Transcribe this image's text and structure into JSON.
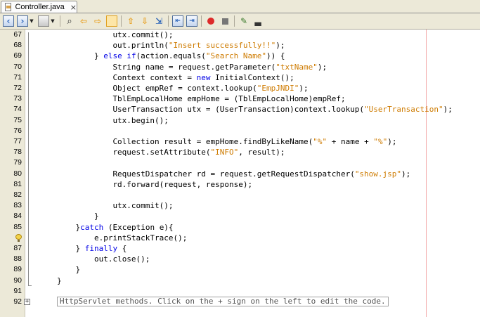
{
  "tab": {
    "label": "Controller.java",
    "close": "×"
  },
  "toolbar": {
    "buttons": [
      "back-icon",
      "forward-icon",
      "history-icon",
      "find-icon",
      "find-previous-icon",
      "find-next-icon",
      "toggle-highlight-icon",
      "previous-bookmark-icon",
      "next-bookmark-icon",
      "toggle-bookmark-icon",
      "shift-left-icon",
      "shift-right-icon",
      "start-macro-icon",
      "stop-macro-icon",
      "comment-icon",
      "uncomment-icon"
    ]
  },
  "lines": [
    {
      "n": "67",
      "indent": 12,
      "parts": [
        [
          "utx.commit();",
          ""
        ]
      ]
    },
    {
      "n": "68",
      "indent": 12,
      "parts": [
        [
          "out.println(",
          ""
        ],
        [
          "\"Insert successfully!!\"",
          "str"
        ],
        [
          ");",
          ""
        ]
      ]
    },
    {
      "n": "69",
      "indent": 8,
      "parts": [
        [
          "} ",
          ""
        ],
        [
          "else if",
          "kw"
        ],
        [
          "(action.equals(",
          ""
        ],
        [
          "\"Search Name\"",
          "str"
        ],
        [
          ")) {",
          ""
        ]
      ]
    },
    {
      "n": "70",
      "indent": 12,
      "parts": [
        [
          "String name = request.getParameter(",
          ""
        ],
        [
          "\"txtName\"",
          "str"
        ],
        [
          ");",
          ""
        ]
      ]
    },
    {
      "n": "71",
      "indent": 12,
      "parts": [
        [
          "Context context = ",
          ""
        ],
        [
          "new",
          "kw"
        ],
        [
          " InitialContext();",
          ""
        ]
      ]
    },
    {
      "n": "72",
      "indent": 12,
      "parts": [
        [
          "Object empRef = context.lookup(",
          ""
        ],
        [
          "\"EmpJNDI\"",
          "str"
        ],
        [
          ");",
          ""
        ]
      ]
    },
    {
      "n": "73",
      "indent": 12,
      "parts": [
        [
          "TblEmpLocalHome empHome = (TblEmpLocalHome)empRef;",
          ""
        ]
      ]
    },
    {
      "n": "74",
      "indent": 12,
      "parts": [
        [
          "UserTransaction utx = (UserTransaction)context.lookup(",
          ""
        ],
        [
          "\"UserTransaction\"",
          "str"
        ],
        [
          ");",
          ""
        ]
      ]
    },
    {
      "n": "75",
      "indent": 12,
      "parts": [
        [
          "utx.begin();",
          ""
        ]
      ]
    },
    {
      "n": "76",
      "indent": 0,
      "parts": []
    },
    {
      "n": "77",
      "indent": 12,
      "parts": [
        [
          "Collection result = empHome.findByLikeName(",
          ""
        ],
        [
          "\"%\"",
          "str"
        ],
        [
          " + name + ",
          ""
        ],
        [
          "\"%\"",
          "str"
        ],
        [
          ");",
          ""
        ]
      ]
    },
    {
      "n": "78",
      "indent": 12,
      "parts": [
        [
          "request.setAttribute(",
          ""
        ],
        [
          "\"INFO\"",
          "str"
        ],
        [
          ", result);",
          ""
        ]
      ]
    },
    {
      "n": "79",
      "indent": 0,
      "parts": []
    },
    {
      "n": "80",
      "indent": 12,
      "parts": [
        [
          "RequestDispatcher rd = request.getRequestDispatcher(",
          ""
        ],
        [
          "\"show.jsp\"",
          "str"
        ],
        [
          ");",
          ""
        ]
      ]
    },
    {
      "n": "81",
      "indent": 12,
      "parts": [
        [
          "rd.forward(request, response);",
          ""
        ]
      ]
    },
    {
      "n": "82",
      "indent": 0,
      "parts": []
    },
    {
      "n": "83",
      "indent": 12,
      "parts": [
        [
          "utx.commit();",
          ""
        ]
      ]
    },
    {
      "n": "84",
      "indent": 8,
      "parts": [
        [
          "}",
          ""
        ]
      ]
    },
    {
      "n": "85",
      "indent": 4,
      "parts": [
        [
          "}",
          ""
        ],
        [
          "catch",
          "kw"
        ],
        [
          " (Exception e){",
          ""
        ]
      ]
    },
    {
      "n": "",
      "indent": 8,
      "parts": [
        [
          "e.printStackTrace();",
          ""
        ]
      ],
      "bulb": true
    },
    {
      "n": "87",
      "indent": 4,
      "parts": [
        [
          "} ",
          ""
        ],
        [
          "finally",
          "kw"
        ],
        [
          " {",
          ""
        ]
      ]
    },
    {
      "n": "88",
      "indent": 8,
      "parts": [
        [
          "out.close();",
          ""
        ]
      ]
    },
    {
      "n": "89",
      "indent": 4,
      "parts": [
        [
          "}",
          ""
        ]
      ]
    },
    {
      "n": "90",
      "indent": 0,
      "parts": [
        [
          "}",
          ""
        ]
      ]
    },
    {
      "n": "91",
      "indent": 0,
      "parts": []
    }
  ],
  "folded": {
    "n": "92",
    "expand": "+",
    "text": "HttpServlet methods. Click on the + sign on the left to edit the code."
  }
}
